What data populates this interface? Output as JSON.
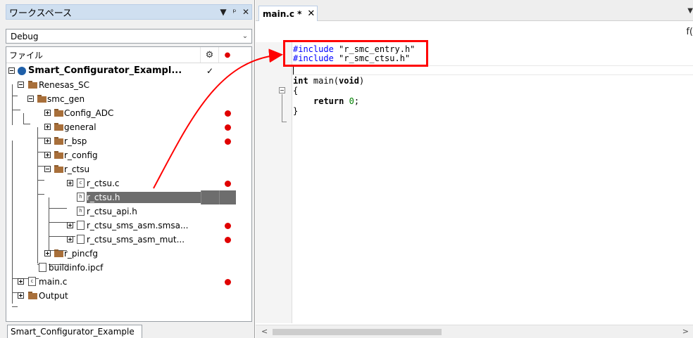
{
  "workspace": {
    "title": "ワークスペース",
    "ctrl_dropdown": "▼",
    "ctrl_pin": "ᵖ",
    "ctrl_close": "✕",
    "config_value": "Debug",
    "header_file": "ファイル",
    "tab_label": "Smart_Configurator_Example"
  },
  "tree": {
    "project": "Smart_Configurator_Exampl...",
    "renesas_sc": "Renesas_SC",
    "smc_gen": "smc_gen",
    "config_adc": "Config_ADC",
    "general": "general",
    "r_bsp": "r_bsp",
    "r_config": "r_config",
    "r_ctsu": "r_ctsu",
    "r_ctsu_c": "r_ctsu.c",
    "r_ctsu_h": "r_ctsu.h",
    "r_ctsu_api_h": "r_ctsu_api.h",
    "sms_asm_smsa": "r_ctsu_sms_asm.smsa...",
    "sms_asm_mut": "r_ctsu_sms_asm_mut...",
    "r_pincfg": "r_pincfg",
    "buildinfo": "buildinfo.ipcf",
    "main_c": "main.c",
    "output": "Output",
    "checkmark": "✓"
  },
  "editor": {
    "tab_label": "main.c *",
    "tab_close": "✕",
    "tab_menu": "▼",
    "func_combo": "f(",
    "code": {
      "include1_kw": "#include",
      "include1_str": "\"r_smc_entry.h\"",
      "include2_kw": "#include",
      "include2_str": "\"r_smc_ctsu.h\"",
      "line_int": "int",
      "line_main": " main(",
      "line_void": "void",
      "line_close": ")",
      "brace_open": "{",
      "return_kw": "return",
      "return_num": "0",
      "return_semi": ";",
      "brace_close": "}"
    }
  },
  "colors": {
    "selection": "#6d6d6d",
    "marker_red": "#e00000",
    "highlight_red": "#ff0000",
    "include_blue": "#0000ff",
    "number_green": "#008000"
  }
}
